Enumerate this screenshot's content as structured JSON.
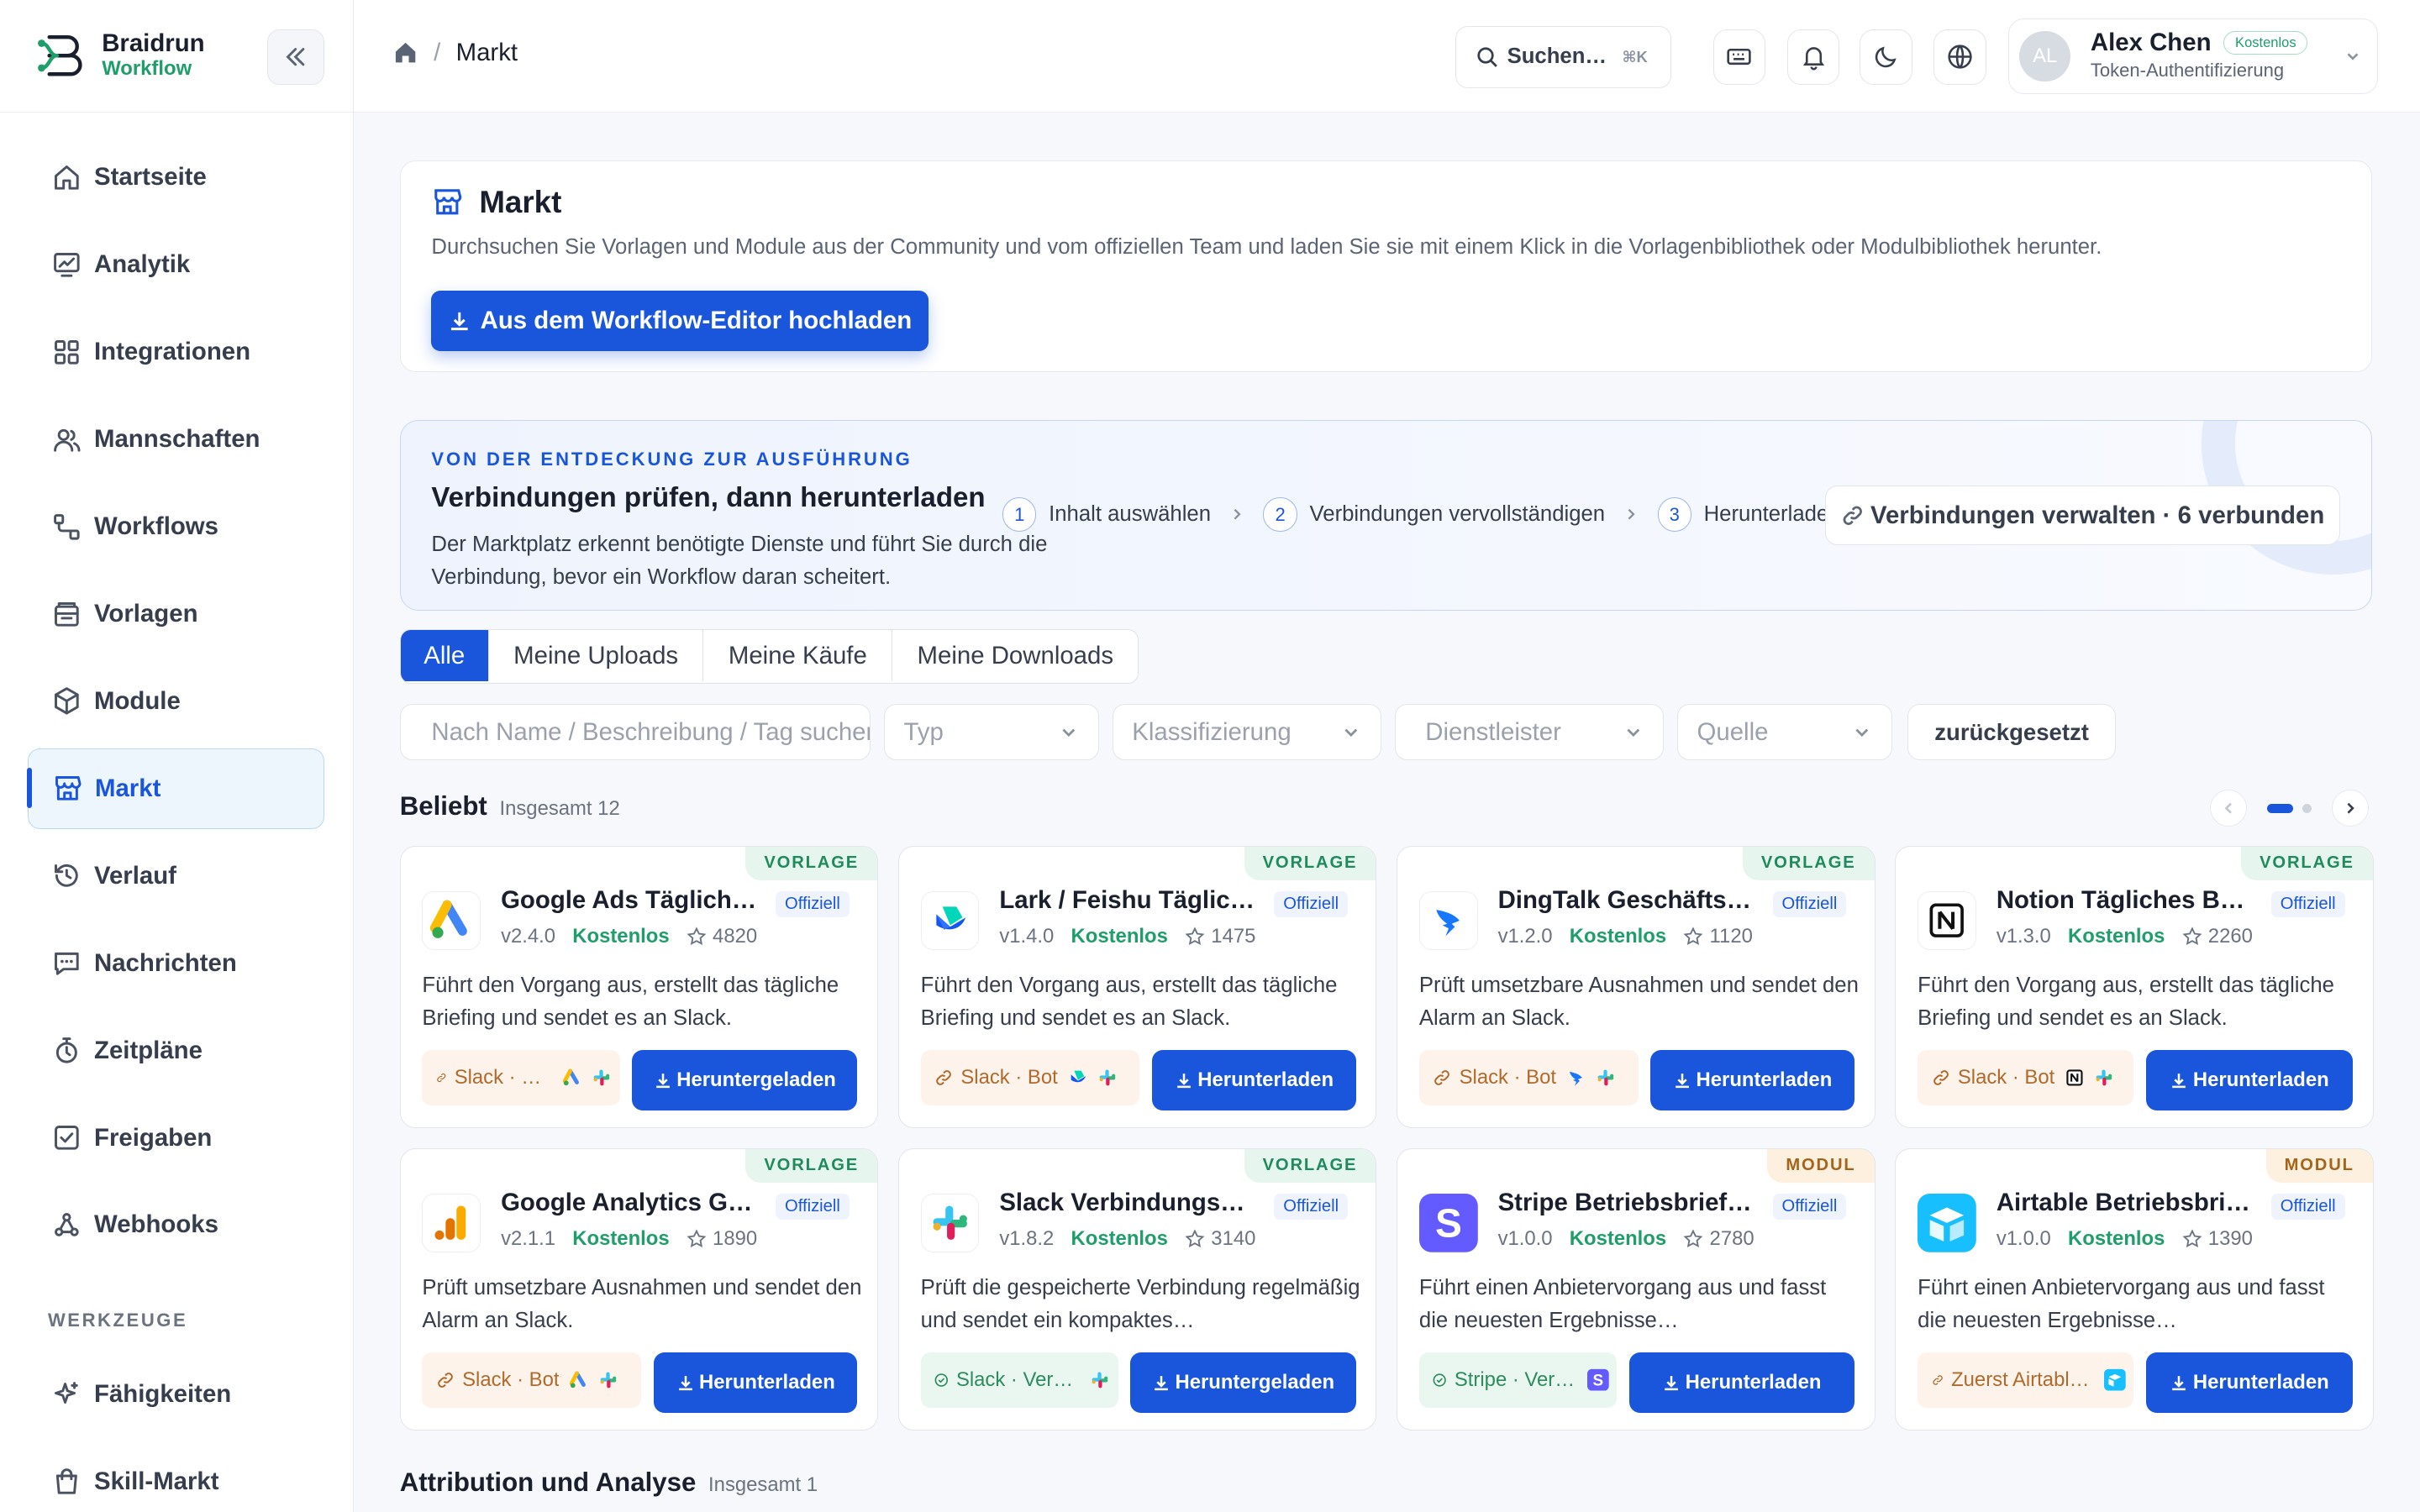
{
  "brand": {
    "name": "Braidrun",
    "sub": "Workflow"
  },
  "sidebar": {
    "items": [
      {
        "label": "Startseite",
        "icon": "home-icon"
      },
      {
        "label": "Analytik",
        "icon": "chart-icon"
      },
      {
        "label": "Integrationen",
        "icon": "grid-icon"
      },
      {
        "label": "Mannschaften",
        "icon": "users-icon"
      },
      {
        "label": "Workflows",
        "icon": "workflow-icon"
      },
      {
        "label": "Vorlagen",
        "icon": "template-icon"
      },
      {
        "label": "Module",
        "icon": "cube-icon"
      },
      {
        "label": "Markt",
        "icon": "store-icon",
        "active": true
      },
      {
        "label": "Verlauf",
        "icon": "history-icon"
      },
      {
        "label": "Nachrichten",
        "icon": "message-icon"
      },
      {
        "label": "Zeitpläne",
        "icon": "timer-icon"
      },
      {
        "label": "Freigaben",
        "icon": "check-square-icon"
      },
      {
        "label": "Webhooks",
        "icon": "webhook-icon"
      }
    ],
    "section": "WERKZEUGE",
    "tools": [
      {
        "label": "Fähigkeiten",
        "icon": "sparkle-icon"
      },
      {
        "label": "Skill-Markt",
        "icon": "bag-icon"
      }
    ]
  },
  "header": {
    "breadcrumb": "Markt",
    "search_label": "Suchen…",
    "search_kbd": "⌘K",
    "user": {
      "initials": "AL",
      "name": "Alex Chen",
      "plan": "Kostenlos",
      "auth": "Token-Authentifizierung"
    }
  },
  "hero": {
    "title": "Markt",
    "desc": "Durchsuchen Sie Vorlagen und Module aus der Community und vom offiziellen Team und laden Sie sie mit einem Klick in die Vorlagenbibliothek oder Modulbibliothek herunter.",
    "upload": "Aus dem Workflow-Editor hochladen"
  },
  "flow": {
    "eyebrow": "VON DER ENTDECKUNG ZUR AUSFÜHRUNG",
    "title": "Verbindungen prüfen, dann herunterladen",
    "desc": "Der Marktplatz erkennt benötigte Dienste und führt Sie durch die Verbindung, bevor ein Workflow daran scheitert.",
    "steps": [
      {
        "n": "1",
        "label": "Inhalt auswählen"
      },
      {
        "n": "2",
        "label": "Verbindungen vervollständigen"
      },
      {
        "n": "3",
        "label": "Herunterladen"
      }
    ],
    "manage": "Verbindungen verwalten · 6 verbunden"
  },
  "tabs": [
    "Alle",
    "Meine Uploads",
    "Meine Käufe",
    "Meine Downloads"
  ],
  "filters": {
    "search_placeholder": "Nach Name / Beschreibung / Tag suchen",
    "type": "Typ",
    "class": "Klassifizierung",
    "provider": "Dienstleister",
    "source": "Quelle",
    "reset": "zurückgesetzt"
  },
  "popular": {
    "title": "Beliebt",
    "count": "Insgesamt 12"
  },
  "attribution": {
    "title": "Attribution und Analyse",
    "count": "Insgesamt 1"
  },
  "labels": {
    "official": "Offiziell",
    "free": "Kostenlos"
  },
  "cards": [
    {
      "kind": "VORLAGE",
      "title": "Google Ads Tägliches Briefing",
      "version": "v2.4.0",
      "stars": "4820",
      "desc": "Führt den Vorgang aus, erstellt das tägliche Briefing und sendet es an Slack.",
      "dep": "Slack · Google Ads",
      "btn": "Heruntergeladen",
      "logo": "google-ads-logo"
    },
    {
      "kind": "VORLAGE",
      "title": "Lark / Feishu Tägliches Briefing",
      "version": "v1.4.0",
      "stars": "1475",
      "desc": "Führt den Vorgang aus, erstellt das tägliche Briefing und sendet es an Slack.",
      "dep": "Slack · Bot",
      "btn": "Herunterladen",
      "logo": "lark-logo"
    },
    {
      "kind": "VORLAGE",
      "title": "DingTalk Geschäftsalarm",
      "version": "v1.2.0",
      "stars": "1120",
      "desc": "Prüft umsetzbare Ausnahmen und sendet den Alarm an Slack.",
      "dep": "Slack · Bot",
      "btn": "Herunterladen",
      "logo": "dingtalk-logo"
    },
    {
      "kind": "VORLAGE",
      "title": "Notion Tägliches Betriebsbriefing",
      "version": "v1.3.0",
      "stars": "2260",
      "desc": "Führt den Vorgang aus, erstellt das tägliche Briefing und sendet es an Slack.",
      "dep": "Slack · Bot",
      "btn": "Herunterladen",
      "logo": "notion-logo"
    },
    {
      "kind": "VORLAGE",
      "title": "Google Analytics Geschäftsalarm",
      "version": "v2.1.1",
      "stars": "1890",
      "desc": "Prüft umsetzbare Ausnahmen und sendet den Alarm an Slack.",
      "dep": "Slack · Bot",
      "btn": "Herunterladen",
      "logo": "google-analytics-logo"
    },
    {
      "kind": "VORLAGE",
      "title": "Slack Verbindungsmonitor",
      "version": "v1.8.2",
      "stars": "3140",
      "desc": "Prüft die gespeicherte Verbindung regelmäßig und sendet ein kompaktes…",
      "dep": "Slack · Verbunden",
      "btn": "Heruntergeladen",
      "logo": "slack-logo"
    },
    {
      "kind": "MODUL",
      "title": "Stripe Betriebsbriefing",
      "version": "v1.0.0",
      "stars": "2780",
      "desc": "Führt einen Anbietervorgang aus und fasst die neuesten Ergebnisse…",
      "dep": "Stripe · Verbunden",
      "btn": "Herunterladen",
      "logo": "stripe-logo"
    },
    {
      "kind": "MODUL",
      "title": "Airtable Betriebsbriefing",
      "version": "v1.0.0",
      "stars": "1390",
      "desc": "Führt einen Anbietervorgang aus und fasst die neuesten Ergebnisse…",
      "dep": "Zuerst Airtable verbinden",
      "btn": "Herunterladen",
      "logo": "airtable-logo"
    }
  ]
}
